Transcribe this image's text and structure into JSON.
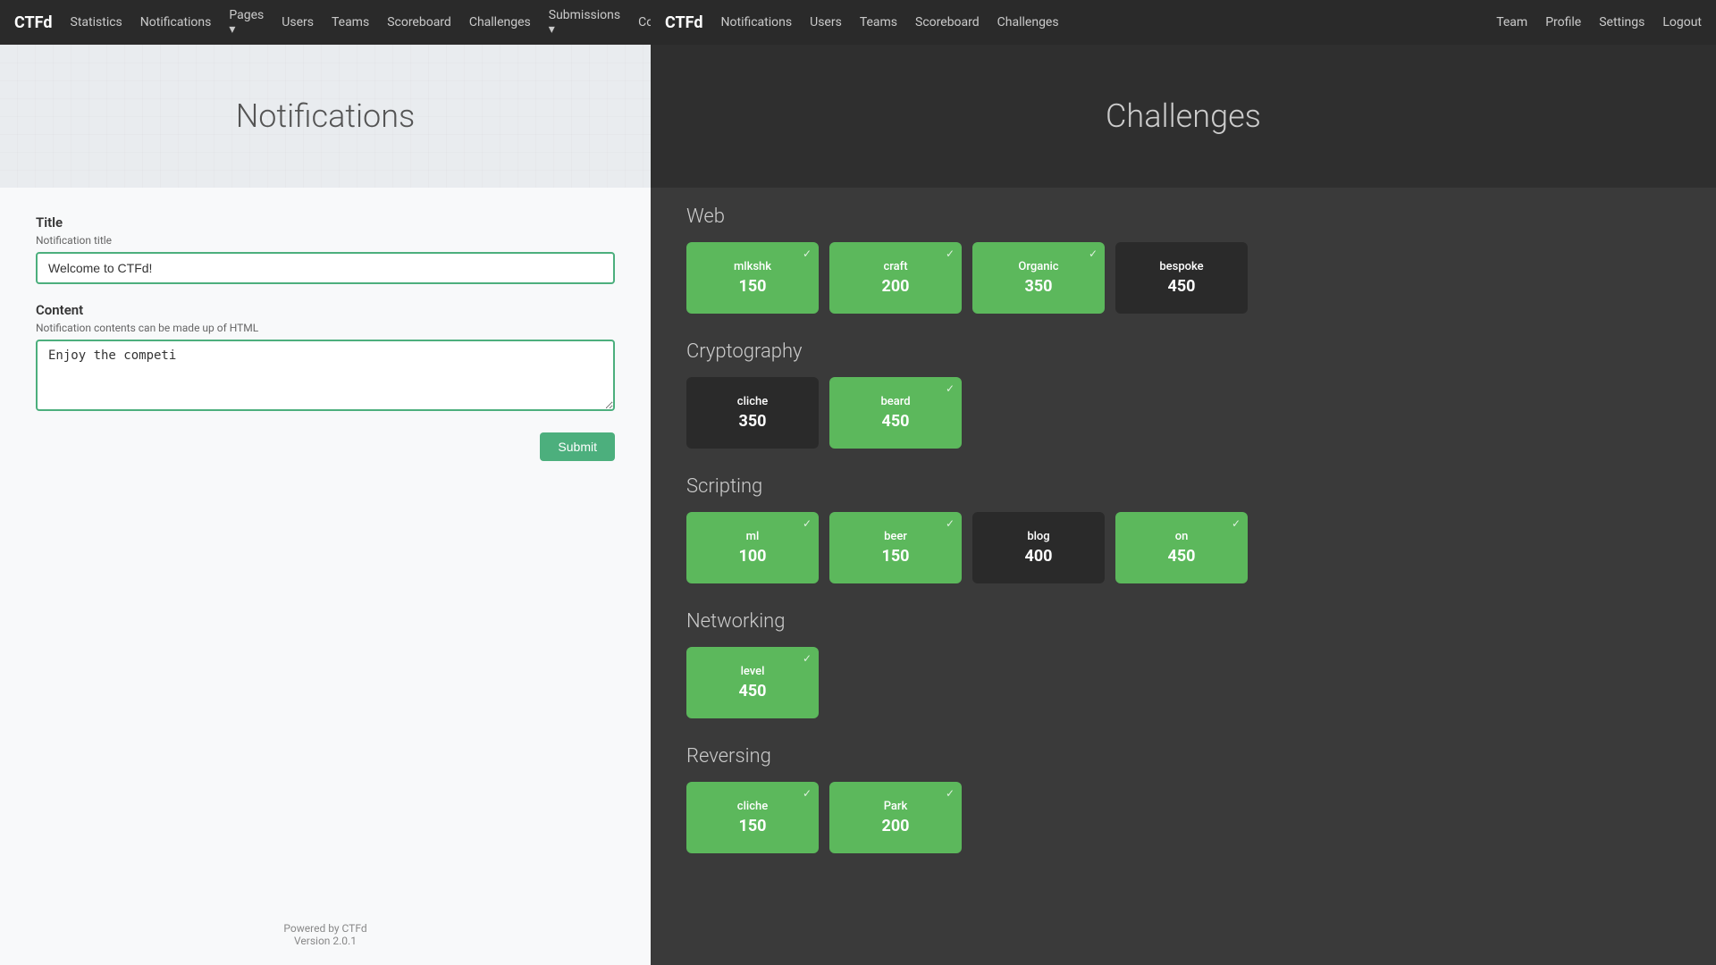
{
  "left": {
    "navbar": {
      "brand": "CTFd",
      "links": [
        "Statistics",
        "Notifications",
        "Pages",
        "Users",
        "Teams",
        "Scoreboard",
        "Challenges",
        "Submissions",
        "Config"
      ]
    },
    "hero": {
      "title": "Notifications"
    },
    "form": {
      "title_label": "Title",
      "title_hint": "Notification title",
      "title_value": "Welcome to CTFd!",
      "title_placeholder": "Notification title",
      "content_label": "Content",
      "content_hint": "Notification contents can be made up of HTML",
      "content_value": "Enjoy the competi",
      "content_placeholder": "",
      "submit_label": "Submit"
    },
    "footer": {
      "line1": "Powered by CTFd",
      "line2": "Version 2.0.1"
    }
  },
  "right": {
    "navbar": {
      "brand": "CTFd",
      "left_links": [
        "Notifications",
        "Users",
        "Teams",
        "Scoreboard",
        "Challenges"
      ],
      "right_links": [
        "Team",
        "Profile",
        "Settings",
        "Logout"
      ]
    },
    "hero": {
      "title": "Challenges"
    },
    "categories": [
      {
        "name": "Web",
        "challenges": [
          {
            "name": "mlkshk",
            "points": "150",
            "solved": true
          },
          {
            "name": "craft",
            "points": "200",
            "solved": true
          },
          {
            "name": "Organic",
            "points": "350",
            "solved": true
          },
          {
            "name": "bespoke",
            "points": "450",
            "solved": false
          }
        ]
      },
      {
        "name": "Cryptography",
        "challenges": [
          {
            "name": "cliche",
            "points": "350",
            "solved": false
          },
          {
            "name": "beard",
            "points": "450",
            "solved": true
          }
        ]
      },
      {
        "name": "Scripting",
        "challenges": [
          {
            "name": "ml",
            "points": "100",
            "solved": true
          },
          {
            "name": "beer",
            "points": "150",
            "solved": true
          },
          {
            "name": "blog",
            "points": "400",
            "solved": false
          },
          {
            "name": "on",
            "points": "450",
            "solved": true
          }
        ]
      },
      {
        "name": "Networking",
        "challenges": [
          {
            "name": "level",
            "points": "450",
            "solved": true
          }
        ]
      },
      {
        "name": "Reversing",
        "challenges": [
          {
            "name": "cliche",
            "points": "150",
            "solved": true
          },
          {
            "name": "Park",
            "points": "200",
            "solved": true
          }
        ]
      }
    ]
  },
  "colors": {
    "solved_bg": "#5cb85c",
    "unsolved_bg": "#2a2a2a",
    "accent": "#4caf7d"
  }
}
